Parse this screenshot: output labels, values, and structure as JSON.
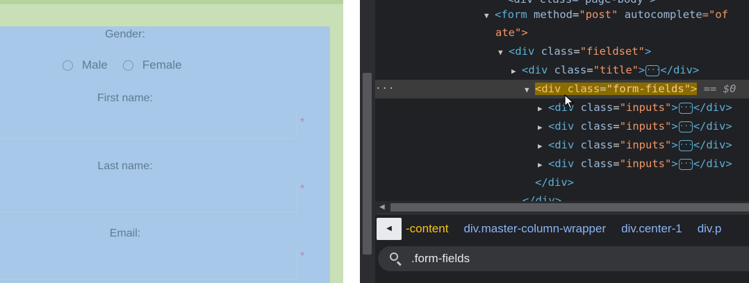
{
  "page": {
    "form": {
      "gender_label": "Gender:",
      "gender_options": [
        "Male",
        "Female"
      ],
      "first_name_label": "First name:",
      "last_name_label": "Last name:",
      "email_label": "Email:",
      "required_mark": "*"
    }
  },
  "devtools": {
    "dom_lines": {
      "l0_text": "<div class=\"page-body\">",
      "l1_tag": "<form",
      "l1_attr1": "method",
      "l1_val1": "\"post\"",
      "l1_attr2": "autocomplete",
      "l1_val2": "=\"of",
      "l1_wrap": "ate\">",
      "l2_tag": "<div",
      "l2_attr": "class",
      "l2_val": "\"fieldset\"",
      "l3_tag": "<div",
      "l3_attr": "class",
      "l3_val": "\"title\"",
      "close_div": "</div>",
      "selected_tag": "<div",
      "selected_attr": "class",
      "selected_val": "\"form-fields\"",
      "selected_ref": "== $0",
      "child_tag": "<div",
      "child_attr": "class",
      "child_val": "\"inputs\"",
      "ellipsis": "···",
      "closing_div": "</div>",
      "partial_last": "</div>"
    },
    "row_menu": "···",
    "breadcrumbs": {
      "back": "◀",
      "items": [
        "-content",
        "div.master-column-wrapper",
        "div.center-1",
        "div.p"
      ]
    },
    "search": {
      "value": ".form-fields"
    }
  }
}
